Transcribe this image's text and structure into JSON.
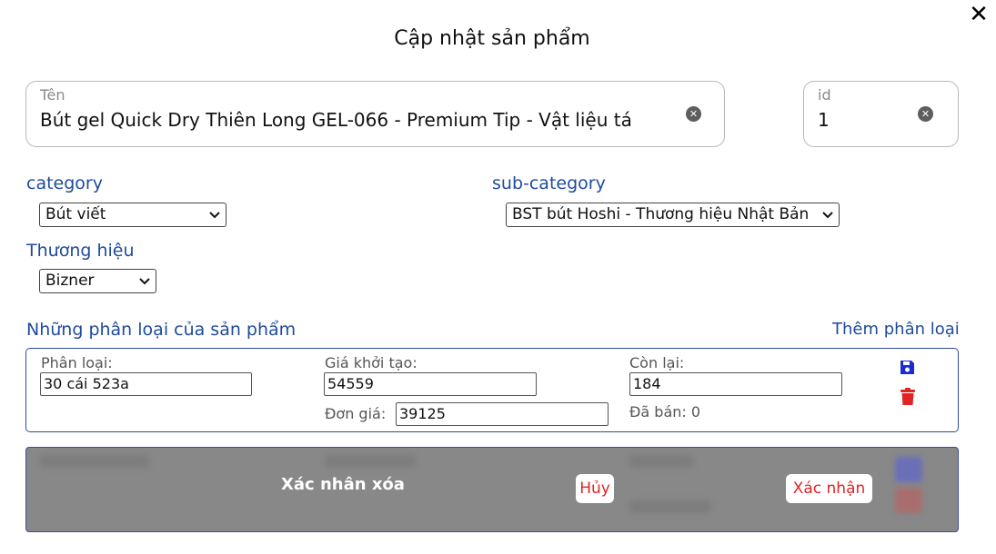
{
  "dialog": {
    "title": "Cập nhật sản phẩm"
  },
  "icons": {
    "close": "close-icon",
    "clear": "clear-circle-icon",
    "save": "floppy-disk-icon",
    "delete": "trash-icon",
    "dropdown": "chevron-down-icon"
  },
  "fields": {
    "name": {
      "label": "Tên",
      "value": "Bút gel Quick Dry Thiên Long GEL-066 - Premium Tip - Vật liệu tá"
    },
    "id": {
      "label": "id",
      "value": "1"
    }
  },
  "selects": {
    "category": {
      "label": "category",
      "value": "Bút viết"
    },
    "sub_category": {
      "label": "sub-category",
      "value": "BST bút Hoshi - Thương hiệu Nhật Bản"
    },
    "brand": {
      "label": "Thương hiệu",
      "value": "Bizner"
    }
  },
  "variants": {
    "section_title": "Những phân loại của sản phẩm",
    "add_link": "Thêm phân loại",
    "item": {
      "type_label": "Phân loại:",
      "type_value": "30 cái 523a",
      "initial_price_label": "Giá khởi tạo:",
      "initial_price_value": "54559",
      "unit_price_label": "Đơn giá:",
      "unit_price_value": "39125",
      "remaining_label": "Còn lại:",
      "remaining_value": "184",
      "sold_text": "Đã bán: 0"
    }
  },
  "confirm_delete": {
    "message": "Xác nhân xóa",
    "cancel_label": "Hủy",
    "confirm_label": "Xác nhận"
  },
  "colors": {
    "accent_blue": "#1f4b9e",
    "save_blue": "#1a2bd6",
    "delete_red": "#e02424",
    "overlay_gray": "#888888"
  }
}
